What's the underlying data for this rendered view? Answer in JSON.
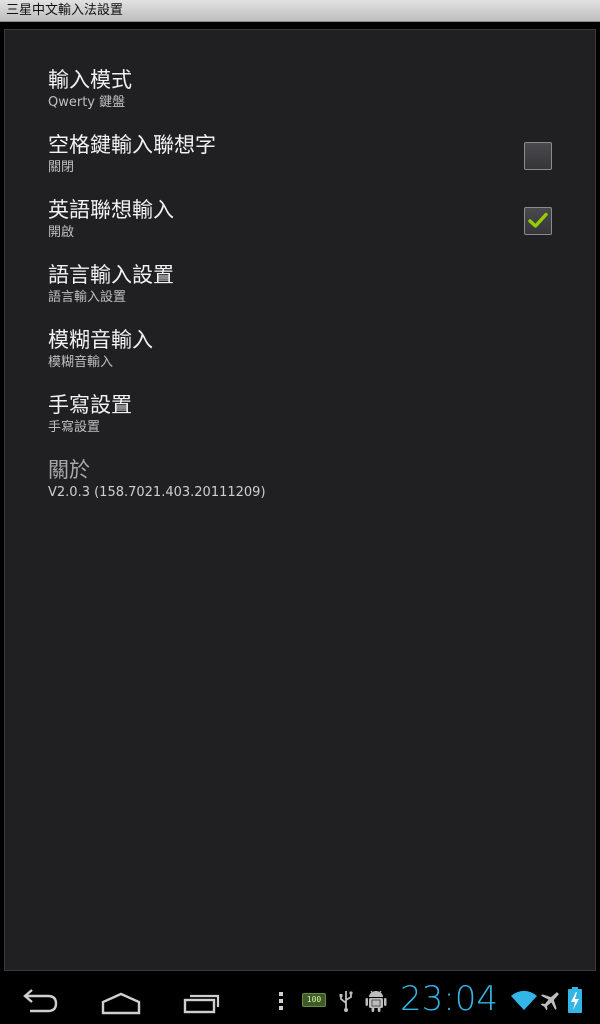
{
  "window": {
    "title": "三星中文輸入法設置"
  },
  "preferences": [
    {
      "title": "輸入模式",
      "summary": "Qwerty 鍵盤",
      "has_checkbox": false
    },
    {
      "title": "空格鍵輸入聯想字",
      "summary": "關閉",
      "has_checkbox": true,
      "checked": false
    },
    {
      "title": "英語聯想輸入",
      "summary": "開啟",
      "has_checkbox": true,
      "checked": true
    },
    {
      "title": "語言輸入設置",
      "summary": "語言輸入設置",
      "has_checkbox": false
    },
    {
      "title": "模糊音輸入",
      "summary": "模糊音輸入",
      "has_checkbox": false
    },
    {
      "title": "手寫設置",
      "summary": "手寫設置",
      "has_checkbox": false
    },
    {
      "title": "關於",
      "summary": "V2.0.3 (158.7021.403.20111209)",
      "has_checkbox": false,
      "disabled": true
    }
  ],
  "navbar": {
    "buttons": [
      "back-icon",
      "home-icon",
      "recent-apps-icon"
    ],
    "status_icons": [
      "menu-dots-icon",
      "battery-100-icon",
      "usb-icon",
      "android-debug-icon",
      "wifi-icon",
      "airplane-icon",
      "battery-charging-icon"
    ],
    "battery_level": "100",
    "clock": "23:04"
  },
  "colors": {
    "background": "#202023",
    "accent": "#33b5e5",
    "check": "#99cc00"
  }
}
